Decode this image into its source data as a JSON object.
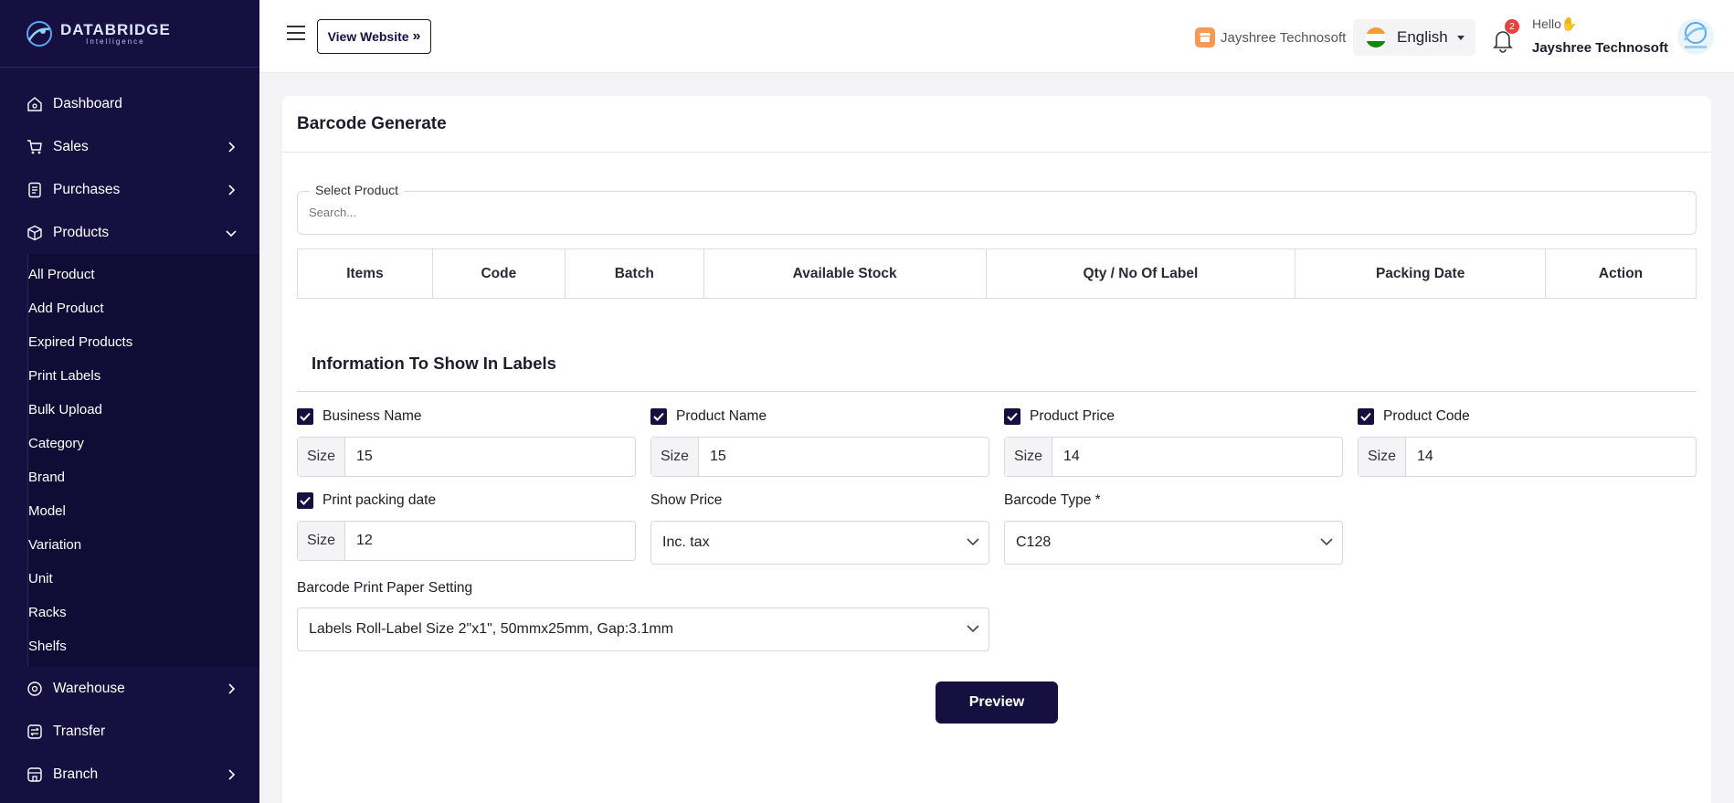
{
  "brand": {
    "name": "DATABRIDGE",
    "sub": "Intelligence"
  },
  "sidebar": {
    "items": [
      {
        "label": "Dashboard"
      },
      {
        "label": "Sales"
      },
      {
        "label": "Purchases"
      },
      {
        "label": "Products"
      },
      {
        "label": "Warehouse"
      },
      {
        "label": "Transfer"
      },
      {
        "label": "Branch"
      }
    ],
    "products_sub": [
      "All Product",
      "Add Product",
      "Expired Products",
      "Print Labels",
      "Bulk Upload",
      "Category",
      "Brand",
      "Model",
      "Variation",
      "Unit",
      "Racks",
      "Shelfs"
    ]
  },
  "header": {
    "view_website": "View Website",
    "company": "Jayshree Technosoft",
    "language": "English",
    "notification_count": "2",
    "hello": "Hello",
    "username": "Jayshree Technosoft"
  },
  "page": {
    "title": "Barcode Generate",
    "select_product_label": "Select Product",
    "search_placeholder": "Search...",
    "table_headers": [
      "Items",
      "Code",
      "Batch",
      "Available Stock",
      "Qty / No Of Label",
      "Packing Date",
      "Action"
    ],
    "info_title": "Information To Show In Labels",
    "size_label": "Size",
    "options": [
      {
        "label": "Business Name",
        "size": "15"
      },
      {
        "label": "Product Name",
        "size": "15"
      },
      {
        "label": "Product Price",
        "size": "14"
      },
      {
        "label": "Product Code",
        "size": "14"
      },
      {
        "label": "Print packing date",
        "size": "12"
      }
    ],
    "show_price_label": "Show Price",
    "show_price_value": "Inc. tax",
    "barcode_type_label": "Barcode Type *",
    "barcode_type_value": "C128",
    "paper_setting_label": "Barcode Print Paper Setting",
    "paper_setting_value": "Labels Roll-Label Size 2\"x1\", 50mmx25mm, Gap:3.1mm",
    "preview_button": "Preview"
  },
  "colors": {
    "sidebar_bg": "#15103f",
    "accent": "#15103f",
    "badge": "#e8413c"
  }
}
